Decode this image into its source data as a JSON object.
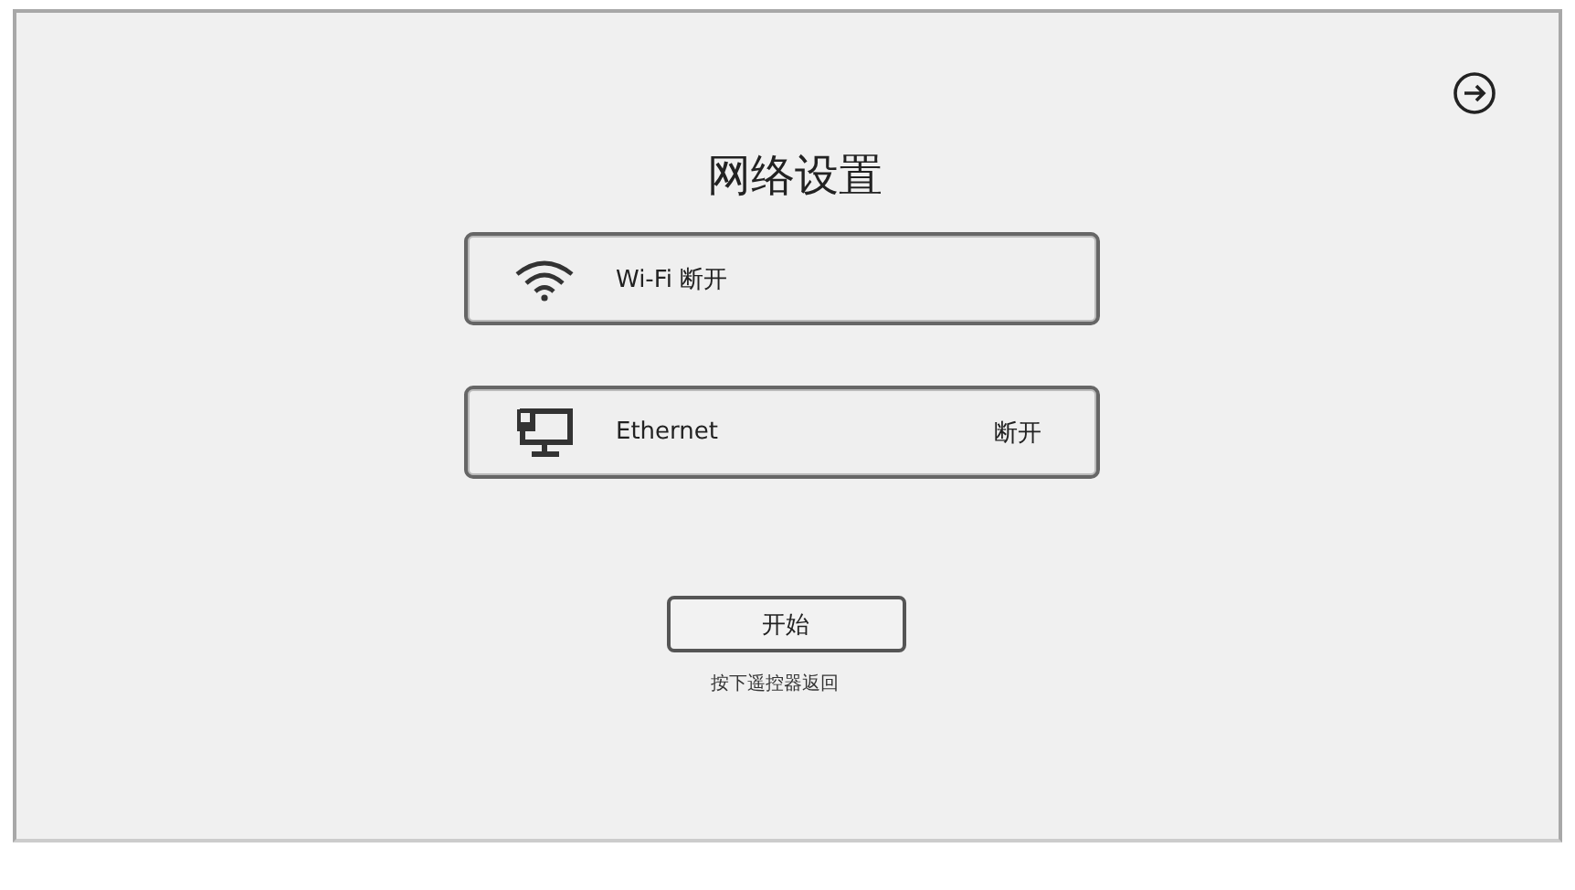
{
  "title": "网络设置",
  "networks": [
    {
      "kind": "wifi",
      "label": "Wi-Fi 断开"
    },
    {
      "kind": "ethernet",
      "label": "Ethernet",
      "status": "断开"
    }
  ],
  "start_button": "开始",
  "hint": "按下遥控器返回"
}
